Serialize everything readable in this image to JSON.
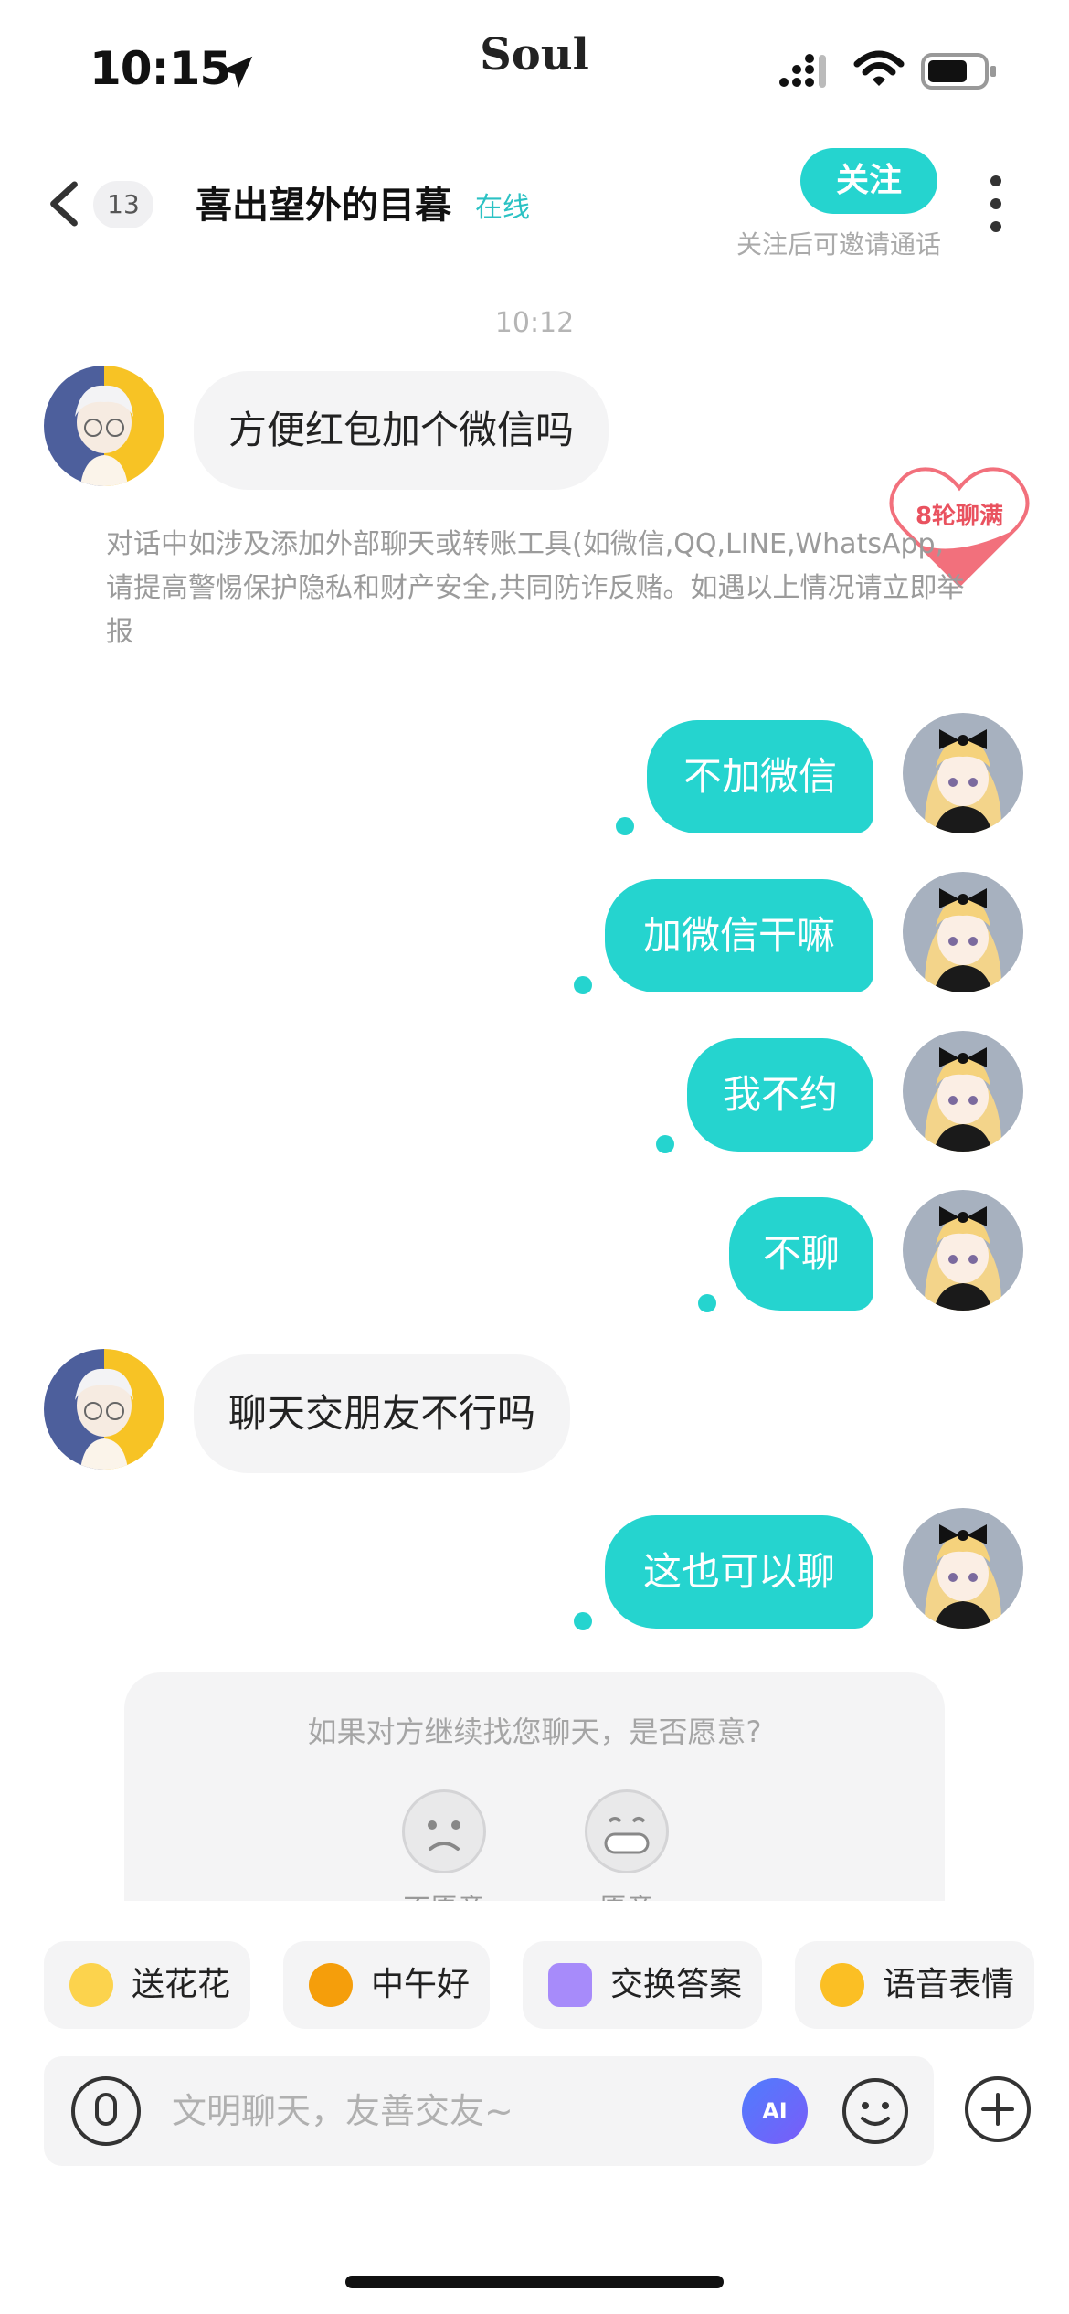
{
  "status_bar": {
    "time": "10:15",
    "app_brand": "Soul"
  },
  "header": {
    "unread_count": "13",
    "nickname": "喜出望外的目暮",
    "online_status": "在线",
    "follow_label": "关注",
    "follow_hint": "关注后可邀请通话"
  },
  "conversation": {
    "timestamp": "10:12",
    "messages": [
      {
        "side": "in",
        "text": "方便红包加个微信吗"
      },
      {
        "side": "out",
        "text": "不加微信"
      },
      {
        "side": "out",
        "text": "加微信干嘛"
      },
      {
        "side": "out",
        "text": "我不约"
      },
      {
        "side": "out",
        "text": "不聊"
      },
      {
        "side": "in",
        "text": "聊天交朋友不行吗"
      },
      {
        "side": "out",
        "text": "这也可以聊"
      }
    ],
    "safety_warning": "对话中如涉及添加外部聊天或转账工具(如微信,QQ,LINE,WhatsApp,请提高警惕保护隐私和财产安全,共同防诈反赌。如遇以上情况请立即举报",
    "rounds_badge": "8轮聊满"
  },
  "willingness_card": {
    "question": "如果对方继续找您聊天，是否愿意?",
    "option_no": "不愿意",
    "option_yes": "愿意"
  },
  "quick_actions": [
    {
      "label": "送花花",
      "icon": "flower-emoji-icon"
    },
    {
      "label": "中午好",
      "icon": "sun-sunglasses-icon"
    },
    {
      "label": "交换答案",
      "icon": "swap-icon"
    },
    {
      "label": "语音表情",
      "icon": "voice-emoji-icon"
    }
  ],
  "input": {
    "placeholder": "文明聊天，友善交友~",
    "ai_label": "AI"
  },
  "colors": {
    "accent": "#25d4cf",
    "incoming_bubble": "#f4f4f5",
    "warning_text": "#9b9b9b"
  }
}
